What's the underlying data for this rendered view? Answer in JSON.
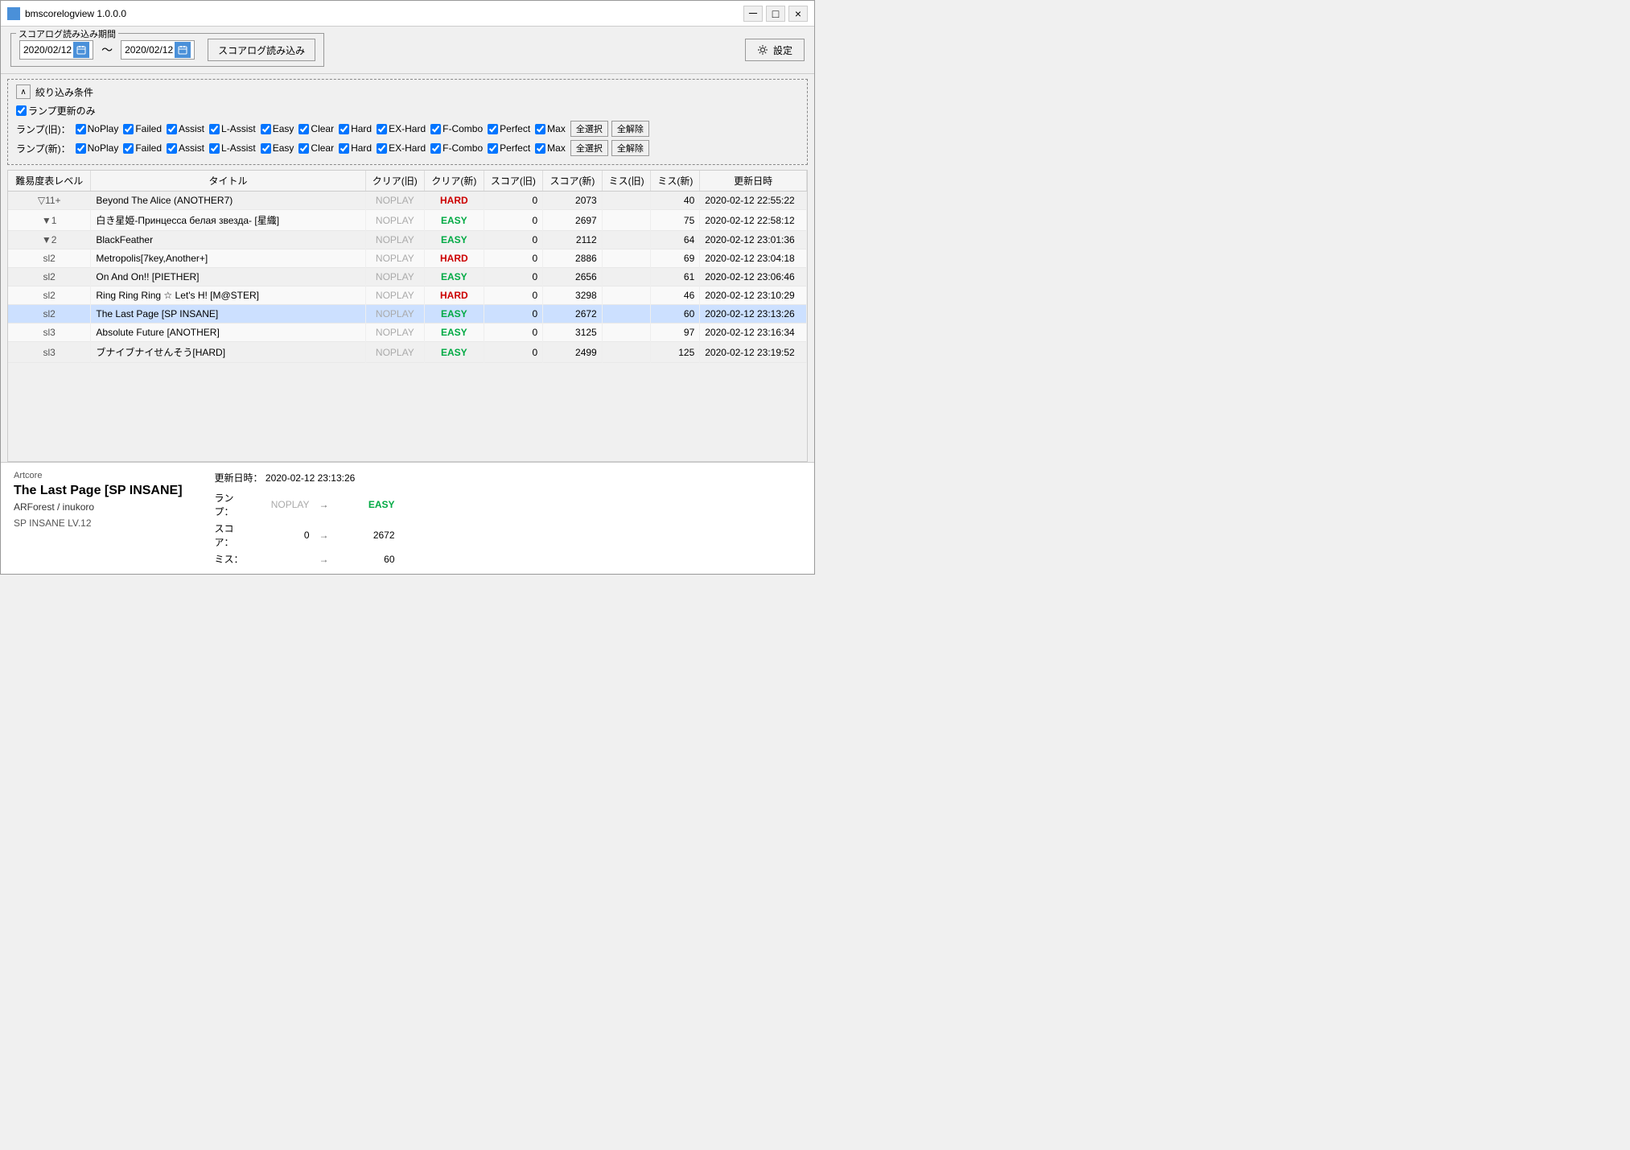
{
  "window": {
    "title": "bmscorelogview 1.0.0.0",
    "minimize": "－",
    "maximize": "□",
    "close": "×"
  },
  "topbar": {
    "group_label": "スコアログ読み込み期間",
    "date_from": "2020/02/12",
    "date_to": "2020/02/12",
    "load_btn": "スコアログ読み込み",
    "settings_btn": "設定"
  },
  "filter": {
    "header": "絞り込み条件",
    "lamp_update_only_label": "ランプ更新のみ",
    "old_lamp_label": "ランプ(旧)：",
    "new_lamp_label": "ランプ(新)：",
    "lamps": [
      "NoPlay",
      "Failed",
      "Assist",
      "L-Assist",
      "Easy",
      "Clear",
      "Hard",
      "EX-Hard",
      "F-Combo",
      "Perfect",
      "Max"
    ],
    "all_select": "全選択",
    "all_clear": "全解除"
  },
  "table": {
    "headers": [
      "難易度表レベル",
      "タイトル",
      "クリア(旧)",
      "クリア(新)",
      "スコア(旧)",
      "スコア(新)",
      "ミス(旧)",
      "ミス(新)",
      "更新日時"
    ],
    "rows": [
      {
        "level": "▽11+",
        "title": "Beyond The Alice (ANOTHER7)",
        "clear_old": "NOPLAY",
        "clear_new": "HARD",
        "score_old": 0,
        "score_new": 2073,
        "miss_old": "",
        "miss_new": 40,
        "datetime": "2020-02-12 22:55:22",
        "clear_new_class": "lamp-hard"
      },
      {
        "level": "▼1",
        "title": "白き星姫-Принцесса белая звезда- [星織]",
        "clear_old": "NOPLAY",
        "clear_new": "EASY",
        "score_old": 0,
        "score_new": 2697,
        "miss_old": "",
        "miss_new": 75,
        "datetime": "2020-02-12 22:58:12",
        "clear_new_class": "lamp-easy"
      },
      {
        "level": "▼2",
        "title": "BlackFeather",
        "clear_old": "NOPLAY",
        "clear_new": "EASY",
        "score_old": 0,
        "score_new": 2112,
        "miss_old": "",
        "miss_new": 64,
        "datetime": "2020-02-12 23:01:36",
        "clear_new_class": "lamp-easy"
      },
      {
        "level": "sl2",
        "title": "Metropolis[7key,Another+]",
        "clear_old": "NOPLAY",
        "clear_new": "HARD",
        "score_old": 0,
        "score_new": 2886,
        "miss_old": "",
        "miss_new": 69,
        "datetime": "2020-02-12 23:04:18",
        "clear_new_class": "lamp-hard"
      },
      {
        "level": "sl2",
        "title": "On And On!! [PIETHER]",
        "clear_old": "NOPLAY",
        "clear_new": "EASY",
        "score_old": 0,
        "score_new": 2656,
        "miss_old": "",
        "miss_new": 61,
        "datetime": "2020-02-12 23:06:46",
        "clear_new_class": "lamp-easy"
      },
      {
        "level": "sl2",
        "title": "Ring Ring Ring ☆ Let's H! [M@STER]",
        "clear_old": "NOPLAY",
        "clear_new": "HARD",
        "score_old": 0,
        "score_new": 3298,
        "miss_old": "",
        "miss_new": 46,
        "datetime": "2020-02-12 23:10:29",
        "clear_new_class": "lamp-hard"
      },
      {
        "level": "sl2",
        "title": "The Last Page [SP INSANE]",
        "clear_old": "NOPLAY",
        "clear_new": "EASY",
        "score_old": 0,
        "score_new": 2672,
        "miss_old": "",
        "miss_new": 60,
        "datetime": "2020-02-12 23:13:26",
        "clear_new_class": "lamp-easy",
        "selected": true
      },
      {
        "level": "sl3",
        "title": "Absolute Future [ANOTHER]",
        "clear_old": "NOPLAY",
        "clear_new": "EASY",
        "score_old": 0,
        "score_new": 3125,
        "miss_old": "",
        "miss_new": 97,
        "datetime": "2020-02-12 23:16:34",
        "clear_new_class": "lamp-easy"
      },
      {
        "level": "sl3",
        "title": "ブナイブナイせんそう[HARD]",
        "clear_old": "NOPLAY",
        "clear_new": "EASY",
        "score_old": 0,
        "score_new": 2499,
        "miss_old": "",
        "miss_new": 125,
        "datetime": "2020-02-12 23:19:52",
        "clear_new_class": "lamp-easy"
      }
    ]
  },
  "detail": {
    "genre": "Artcore",
    "title": "The Last Page [SP INSANE]",
    "artist": "ARForest / inukoro",
    "level": "SP INSANE LV.12",
    "datetime_label": "更新日時：",
    "datetime_value": "2020-02-12 23:13:26",
    "lamp_label": "ランプ：",
    "lamp_old": "NOPLAY",
    "lamp_new": "EASY",
    "score_label": "スコア：",
    "score_old": "0",
    "score_new": "2672",
    "miss_label": "ミス：",
    "miss_old": "",
    "miss_new": "60",
    "arrow": "→"
  }
}
